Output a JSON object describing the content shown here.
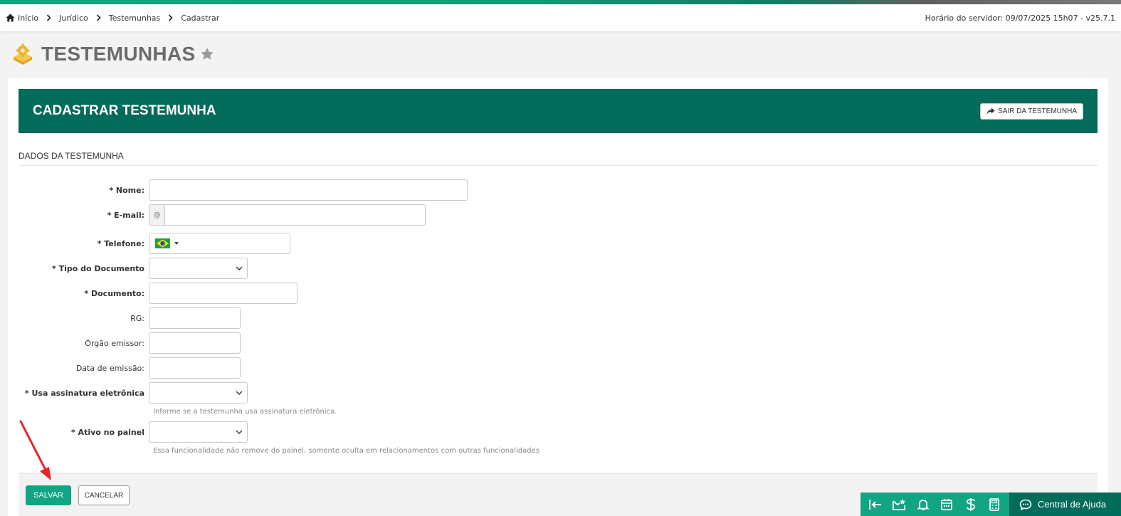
{
  "breadcrumb": {
    "items": [
      "Início",
      "Jurídico",
      "Testemunhas",
      "Cadastrar"
    ]
  },
  "server_info": "Horário do servidor: 09/07/2025 15h07 - v25.7.1",
  "page": {
    "title": "TESTEMUNHAS"
  },
  "card": {
    "title": "CADASTRAR TESTEMUNHA",
    "exit_label": "SAIR DA TESTEMUNHA"
  },
  "section": {
    "title": "DADOS DA TESTEMUNHA"
  },
  "form": {
    "nome": {
      "label": "* Nome:",
      "value": ""
    },
    "email": {
      "label": "* E-mail:",
      "addon": "@",
      "value": ""
    },
    "telefone": {
      "label": "* Telefone:",
      "value": ""
    },
    "tipo_documento": {
      "label": "* Tipo do Documento",
      "value": ""
    },
    "documento": {
      "label": "* Documento:",
      "value": ""
    },
    "rg": {
      "label": "RG:",
      "value": ""
    },
    "orgao_emissor": {
      "label": "Órgão emissor:",
      "value": ""
    },
    "data_emissao": {
      "label": "Data de emissão:",
      "value": ""
    },
    "assinatura": {
      "label": "* Usa assinatura eletrônica",
      "value": "",
      "help": "Informe se a testemunha usa assinatura eletrônica."
    },
    "ativo": {
      "label": "* Ativo no painel",
      "value": "",
      "help": "Essa funcionalidade não remove do painel, somente oculta em relacionamentos com outras funcionalidades"
    }
  },
  "actions": {
    "save_label": "SALVAR",
    "cancel_label": "CANCELAR"
  },
  "dock": {
    "help_label": "Central de Ajuda"
  },
  "colors": {
    "primary_dark": "#026b59",
    "primary": "#12a584",
    "annotation_arrow": "#e8232a"
  }
}
